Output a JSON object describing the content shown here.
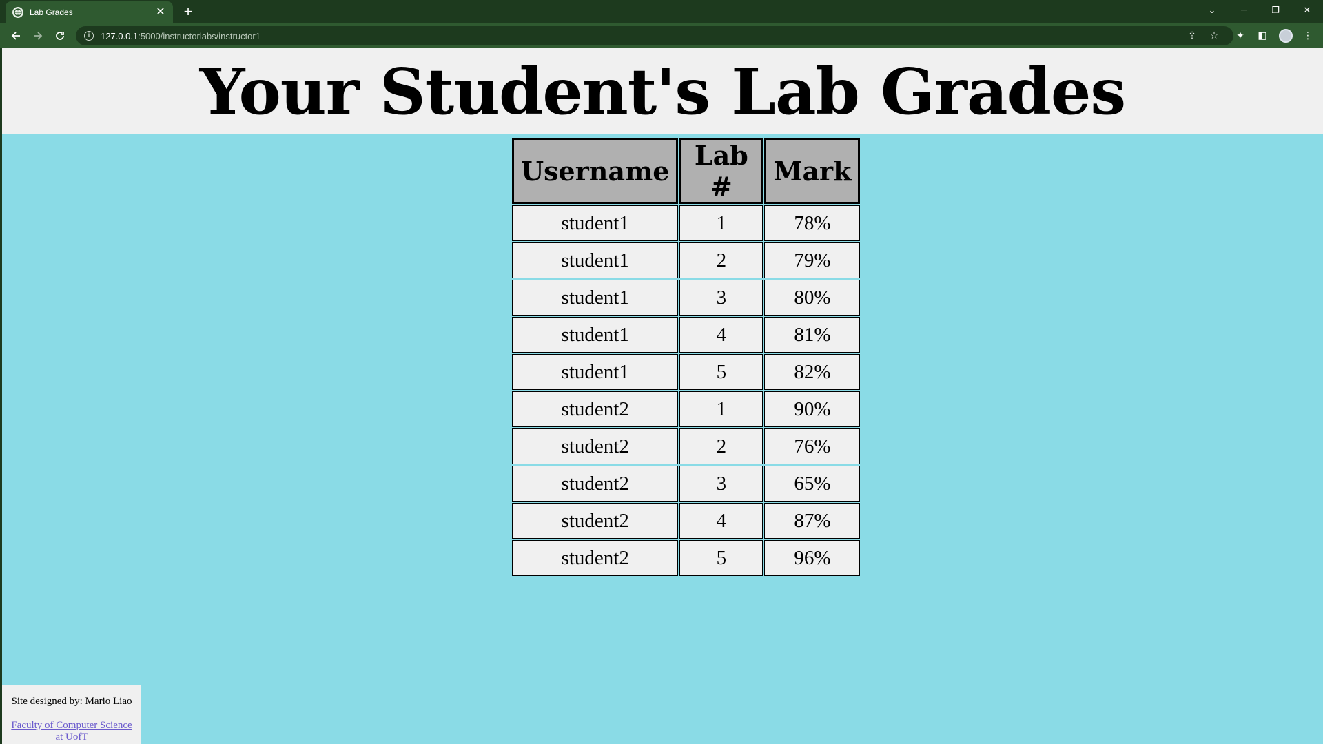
{
  "browser": {
    "tab": {
      "title": "Lab Grades",
      "close_glyph": "✕",
      "icon": "globe-icon"
    },
    "new_tab_glyph": "+",
    "window_controls": {
      "dropdown": "⌄",
      "minimize": "─",
      "restore": "❐",
      "close": "✕"
    },
    "address": {
      "host": "127.0.0.1",
      "path": ":5000/instructorlabs/instructor1"
    }
  },
  "page": {
    "title": "Your Student's Lab Grades",
    "table": {
      "headers": {
        "username": "Username",
        "lab": "Lab #",
        "mark": "Mark"
      },
      "rows": [
        {
          "username": "student1",
          "lab": "1",
          "mark": "78%"
        },
        {
          "username": "student1",
          "lab": "2",
          "mark": "79%"
        },
        {
          "username": "student1",
          "lab": "3",
          "mark": "80%"
        },
        {
          "username": "student1",
          "lab": "4",
          "mark": "81%"
        },
        {
          "username": "student1",
          "lab": "5",
          "mark": "82%"
        },
        {
          "username": "student2",
          "lab": "1",
          "mark": "90%"
        },
        {
          "username": "student2",
          "lab": "2",
          "mark": "76%"
        },
        {
          "username": "student2",
          "lab": "3",
          "mark": "65%"
        },
        {
          "username": "student2",
          "lab": "4",
          "mark": "87%"
        },
        {
          "username": "student2",
          "lab": "5",
          "mark": "96%"
        }
      ]
    },
    "footer": {
      "designer": "Site designed by: Mario Liao",
      "link_line1": "Faculty of Computer Science",
      "link_line2": "at UofT"
    }
  },
  "colors": {
    "page_background": "#8adbe6",
    "header_background": "#f0f0f0",
    "table_header_background": "#b0b0b0",
    "chrome_dark": "#1d3a1e",
    "chrome_toolbar": "#2f5a30",
    "link": "#6a5acd"
  }
}
